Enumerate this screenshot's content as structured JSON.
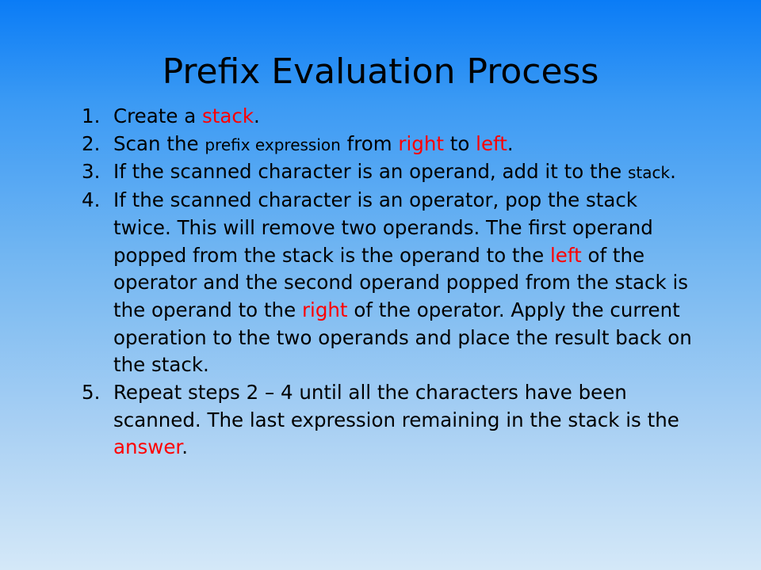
{
  "slide": {
    "title": "Prefix Evaluation Process",
    "highlight_color": "#ff0000",
    "steps": [
      {
        "number": "1.",
        "t1": "Create a ",
        "h1": "stack",
        "t2": "."
      },
      {
        "number": "2.",
        "t1": "Scan the ",
        "small": "prefix expression",
        "t2": " from ",
        "h1": "right",
        "t3": " to ",
        "h2": "left",
        "t4": "."
      },
      {
        "number": "3.",
        "t1": "If the scanned character is an operand, add it to the ",
        "small": "stack",
        "t2": "."
      },
      {
        "number": "4.",
        "t1": "If the scanned character is an operator, pop the stack twice. This will remove two operands. The first operand popped from the stack is the operand to the ",
        "h1": "left",
        "t2": " of the operator and the second operand popped from the stack is the operand to the ",
        "h2": "right",
        "t3": " of the operator. Apply the current operation to the two operands and place the result back on the stack."
      },
      {
        "number": "5.",
        "t1": "Repeat steps 2 – 4 until all the characters have been scanned. The last expression remaining in the stack is the ",
        "h1": "answer",
        "t2": "."
      }
    ]
  }
}
